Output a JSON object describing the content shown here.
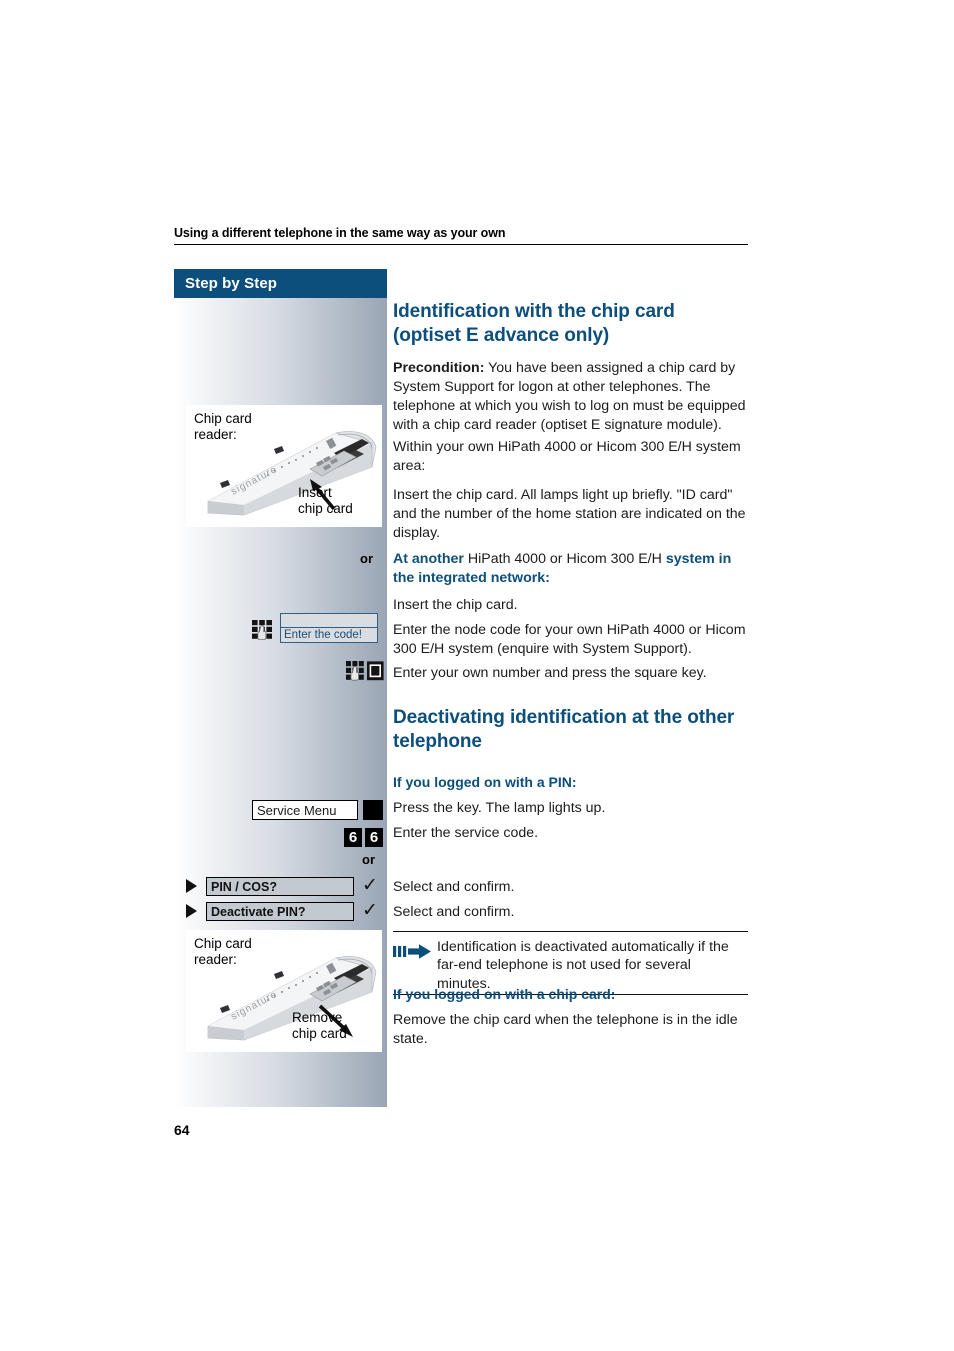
{
  "page": {
    "running_head": "Using a different telephone in the same way as your own",
    "folio": "64",
    "accent_color": "#0c4e7c"
  },
  "sidebar": {
    "banner_label": "Step by Step",
    "figure_top": {
      "label_line1": "Chip card",
      "label_line2": "reader:",
      "device_word": "signature",
      "caption_line1": "Insert",
      "caption_line2": "chip card",
      "icon": "chip-card-reader-photo"
    },
    "figure_bottom": {
      "label_line1": "Chip card",
      "label_line2": "reader:",
      "device_word": "signature",
      "caption_line1": "Remove",
      "caption_line2": "chip card",
      "icon": "chip-card-reader-photo"
    },
    "keypad_icon_name": "keypad-icon",
    "keypad_square_icon_name": "keypad-and-square-key-icon",
    "lcd_display": {
      "line_top": "",
      "line_bottom": "Enter the code!"
    },
    "service_menu_field": "Service Menu",
    "service_menu_key_icon": "black-square-key-icon",
    "digit_keys": [
      "6",
      "6"
    ],
    "or_markers": [
      "or",
      "or"
    ],
    "menu_options": [
      {
        "label": "PIN / COS?",
        "confirm_icon": "check-icon",
        "arrow_icon": "triangle-right-icon"
      },
      {
        "label": "Deactivate PIN?",
        "confirm_icon": "check-icon",
        "arrow_icon": "triangle-right-icon"
      }
    ]
  },
  "content": {
    "heading1_line1": "Identification with the chip card",
    "heading1_line2": "(optiset E advance only)",
    "precondition_label": "Precondition:",
    "precondition_text": " You have been assigned a chip card by System Support for logon at other telephones. The telephone at which you wish to log on must be equipped with a chip card reader (optiset E signature module).",
    "para_within": "Within your own HiPath 4000 or Hicom 300 E/H system area:",
    "para_insert_lamps": "Insert the chip card. All lamps light up briefly. \"ID card\" and the number of the home station are indicated on the display.",
    "at_another_bold1": "At another",
    "at_another_plain": " HiPath 4000 or Hicom 300 E/H ",
    "at_another_bold2": "system in the integrated network:",
    "para_insert_card": "Insert the chip card.",
    "para_node_code": "Enter the node code for your own HiPath 4000 or Hicom 300 E/H system (enquire with System Support).",
    "para_own_number": "Enter your own number and press the square key.",
    "heading2_line1": "Deactivating identification at the other",
    "heading2_line2": "telephone",
    "sub_pin": "If you logged on with a PIN:",
    "para_press_key": "Press the key. The lamp lights up.",
    "para_service_code": "Enter the service code.",
    "para_select_confirm_1": "Select and confirm.",
    "para_select_confirm_2": "Select and confirm.",
    "note": {
      "icon": "blue-arrow-note-icon",
      "text": "Identification is deactivated automatically if the far-end telephone is not used for several minutes."
    },
    "sub_chipcard": "If you logged on with a chip card:",
    "para_remove_card": "Remove the chip card when the telephone is in the idle state."
  }
}
